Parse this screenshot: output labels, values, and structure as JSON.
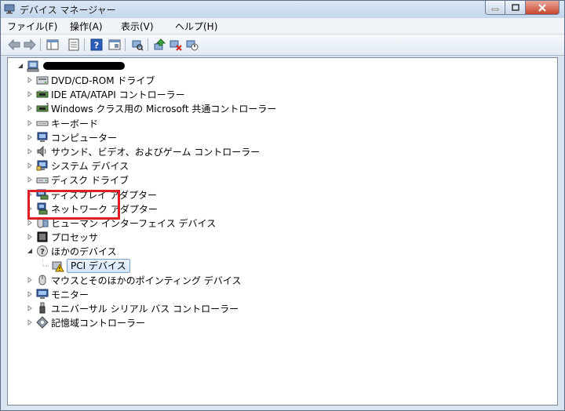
{
  "window": {
    "title": "デバイス マネージャー"
  },
  "menu": [
    "ファイル(F)",
    "操作(A)",
    "表示(V)",
    "ヘルプ(H)"
  ],
  "toolbar": [
    "back-arrow-icon",
    "forward-arrow-icon",
    "show-hide-console-tree-icon",
    "properties-icon",
    "help-icon",
    "view-icon",
    "scan-hardware-icon",
    "update-driver-icon",
    "uninstall-icon",
    "disable-icon"
  ],
  "tree": {
    "root": "",
    "categories": [
      {
        "label": "DVD/CD-ROM ドライブ",
        "icon": "dvd-drive-icon"
      },
      {
        "label": "IDE ATA/ATAPI コントローラー",
        "icon": "ide-controller-icon"
      },
      {
        "label": "Windows クラス用の Microsoft 共通コントローラー",
        "icon": "usb-controller-icon"
      },
      {
        "label": "キーボード",
        "icon": "keyboard-icon"
      },
      {
        "label": "コンピューター",
        "icon": "computer-icon"
      },
      {
        "label": "サウンド、ビデオ、およびゲーム コントローラー",
        "icon": "speaker-icon"
      },
      {
        "label": "システム デバイス",
        "icon": "system-device-icon"
      },
      {
        "label": "ディスク ドライブ",
        "icon": "disk-drive-icon"
      },
      {
        "label": "ディスプレイ アダプター",
        "icon": "display-adapter-icon"
      },
      {
        "label": "ネットワーク アダプター",
        "icon": "network-adapter-icon"
      },
      {
        "label": "ヒューマン インターフェイス デバイス",
        "icon": "hid-icon"
      },
      {
        "label": "プロセッサ",
        "icon": "processor-icon"
      },
      {
        "label": "ほかのデバイス",
        "icon": "unknown-device-icon"
      },
      {
        "label": "PCI デバイス",
        "icon": "warning-device-icon"
      },
      {
        "label": "マウスとそのほかのポインティング デバイス",
        "icon": "mouse-icon"
      },
      {
        "label": "モニター",
        "icon": "monitor-icon"
      },
      {
        "label": "ユニバーサル シリアル バス コントローラー",
        "icon": "usb-plug-icon"
      },
      {
        "label": "記憶域コントローラー",
        "icon": "storage-controller-icon"
      }
    ]
  }
}
